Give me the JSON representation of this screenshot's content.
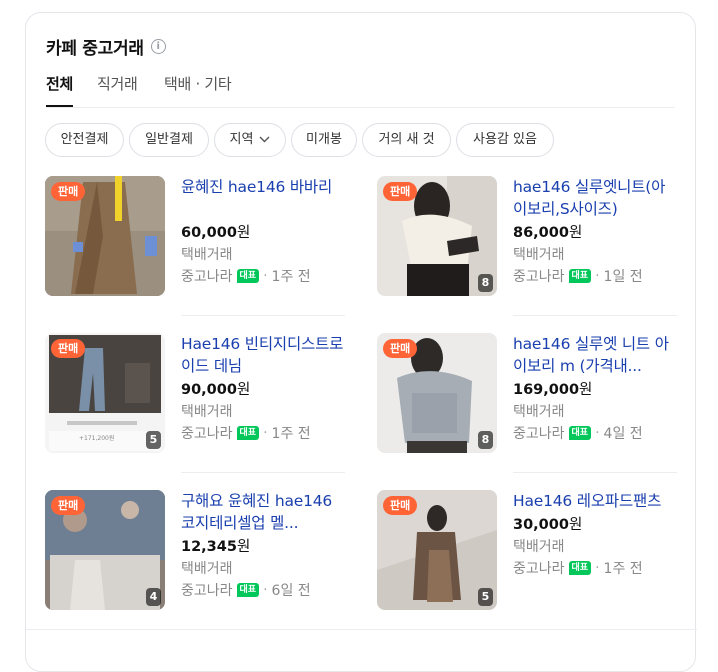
{
  "section": {
    "title": "카페 중고거래",
    "info_icon": "ⓘ",
    "tabs": [
      {
        "label": "전체",
        "active": true
      },
      {
        "label": "직거래",
        "active": false
      },
      {
        "label": "택배 · 기타",
        "active": false
      }
    ],
    "chips": [
      "안전결제",
      "일반결제",
      "지역",
      "미개봉",
      "거의 새 것",
      "사용감 있음"
    ]
  },
  "colors": {
    "sale_badge": "#ff6437",
    "title_link": "#1a3fae",
    "rep_badge": "#03c75a"
  },
  "items": [
    {
      "badge": "판매",
      "title": "윤혜진 hae146 바바리",
      "price": "60,000",
      "currency": "원",
      "shipping": "택배거래",
      "cafe": "중고나라",
      "rep": "대표",
      "time": "1주 전",
      "count": ""
    },
    {
      "badge": "판매",
      "title": "hae146 실루엣니트(아이보리,S사이즈)",
      "price": "86,000",
      "currency": "원",
      "shipping": "택배거래",
      "cafe": "중고나라",
      "rep": "대표",
      "time": "1일 전",
      "count": "8"
    },
    {
      "badge": "판매",
      "title": "Hae146 빈티지디스트로이드 데님",
      "price": "90,000",
      "currency": "원",
      "shipping": "택배거래",
      "cafe": "중고나라",
      "rep": "대표",
      "time": "1주 전",
      "count": "5",
      "thumb_caption": "+171,200원"
    },
    {
      "badge": "판매",
      "title": "hae146 실루엣 니트 아이보리 m (가격내...",
      "price": "169,000",
      "currency": "원",
      "shipping": "택배거래",
      "cafe": "중고나라",
      "rep": "대표",
      "time": "4일 전",
      "count": "8"
    },
    {
      "badge": "판매",
      "title": "구해요 윤혜진 hae146 코지테리셀업 멜...",
      "price": "12,345",
      "currency": "원",
      "shipping": "택배거래",
      "cafe": "중고나라",
      "rep": "대표",
      "time": "6일 전",
      "count": "4"
    },
    {
      "badge": "판매",
      "title": "Hae146 레오파드팬츠",
      "price": "30,000",
      "currency": "원",
      "shipping": "택배거래",
      "cafe": "중고나라",
      "rep": "대표",
      "time": "1주 전",
      "count": "5"
    }
  ]
}
